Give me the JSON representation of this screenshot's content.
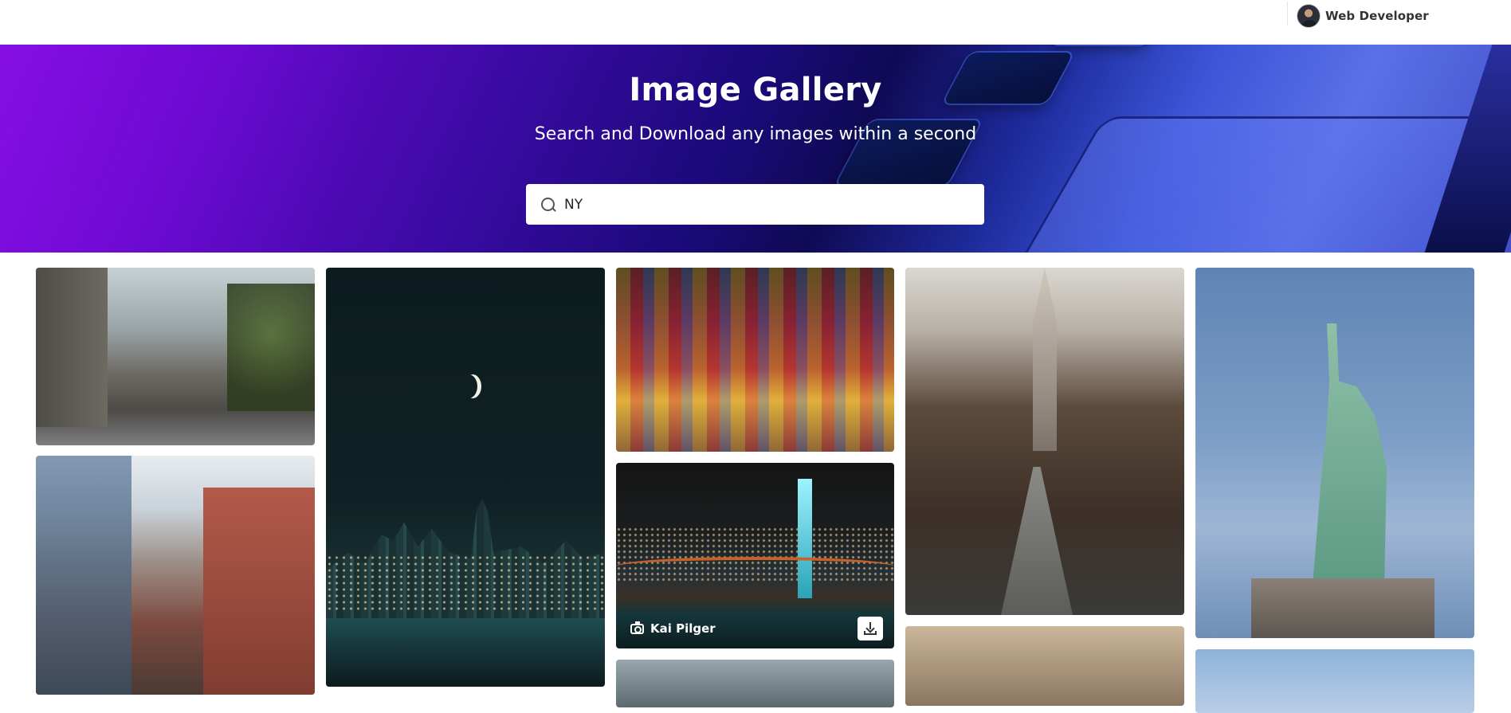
{
  "header": {
    "user": {
      "name": "Web Developer",
      "avatar_icon": "user-avatar"
    }
  },
  "hero": {
    "title": "Image Gallery",
    "subtitle": "Search and Download any images within a second",
    "search": {
      "value": "NY",
      "icon": "search-icon"
    }
  },
  "gallery": {
    "hovered_tile": {
      "photographer": "Kai Pilger",
      "credit_icon": "camera-icon",
      "download_icon": "download-icon"
    }
  },
  "colors": {
    "hero_purple": "#7a06d6",
    "hero_blue": "#3c56d8",
    "text_white": "#ffffff"
  }
}
